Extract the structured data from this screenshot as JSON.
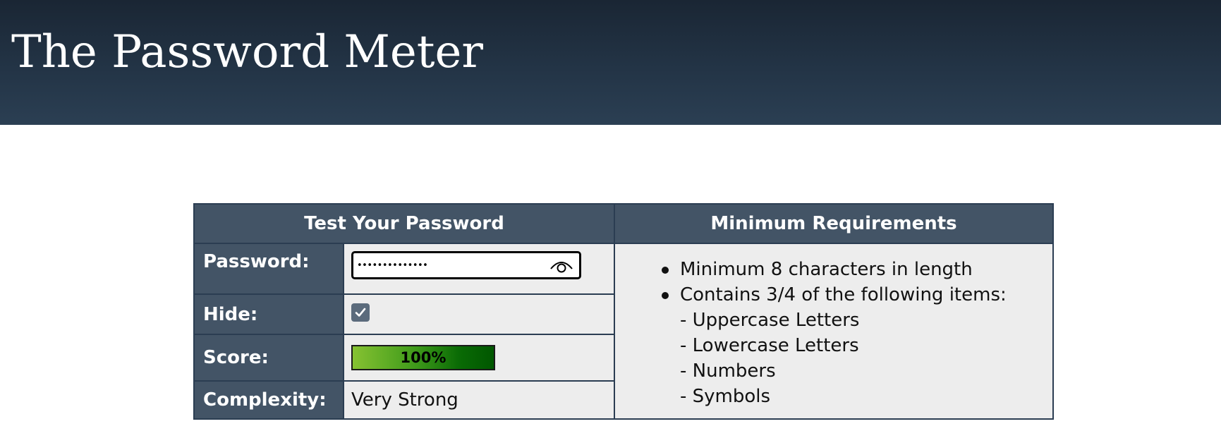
{
  "header": {
    "title": "The Password Meter"
  },
  "meter": {
    "test_heading": "Test Your Password",
    "requirements_heading": "Minimum Requirements",
    "password_label": "Password:",
    "password_value": "••••••••••••••",
    "hide_label": "Hide:",
    "hide_checked": true,
    "score_label": "Score:",
    "score_value": "100%",
    "score_fraction": 1.0,
    "complexity_label": "Complexity:",
    "complexity_value": "Very Strong"
  },
  "requirements": {
    "items": [
      "Minimum 8 characters in length",
      "Contains 3/4 of the following items:",
      "- Uppercase Letters",
      "- Lowercase Letters",
      "- Numbers",
      "- Symbols"
    ]
  },
  "colors": {
    "header_bg": "#1f2e3e",
    "table_header_bg": "#435466",
    "cell_bg": "#ededed",
    "score_green_start": "#86c232",
    "score_green_end": "#005700"
  },
  "icons": {
    "password_toggle": "eye-icon",
    "hide_checkbox": "checkmark-icon"
  }
}
